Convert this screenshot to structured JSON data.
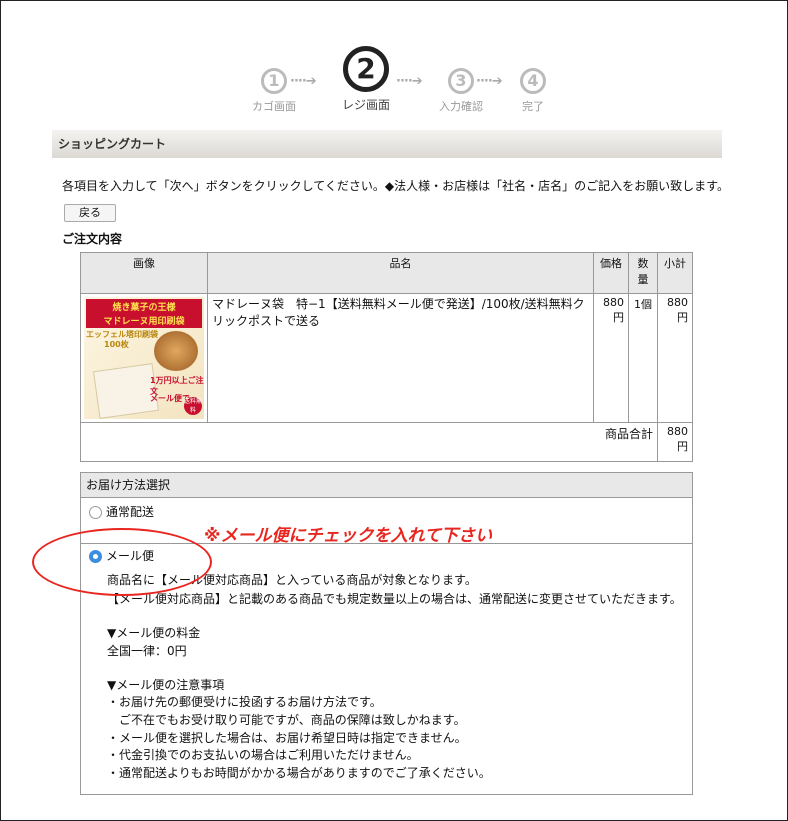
{
  "steps": [
    {
      "num": "1",
      "label": "カゴ画面"
    },
    {
      "num": "2",
      "label": "レジ画面"
    },
    {
      "num": "3",
      "label": "入力確認"
    },
    {
      "num": "4",
      "label": "完了"
    }
  ],
  "arrow": "····➔",
  "cart_header": "ショッピングカート",
  "instruction": "各項目を入力して「次へ」ボタンをクリックしてください。◆法人様・お店様は「社名・店名」のご記入をお願い致します。",
  "back_button": "戻る",
  "order_title": "ご注文内容",
  "table": {
    "headers": {
      "image": "画像",
      "name": "品名",
      "price": "価格",
      "qty": "数量",
      "subtotal": "小計"
    },
    "row": {
      "name": "マドレーヌ袋　特−1【送料無料メール便で発送】/100枚/送料無料クリックポストで送る",
      "price": "880円",
      "qty": "1個",
      "subtotal": "880円"
    },
    "total_label": "商品合計",
    "total_value": "880円",
    "thumb": {
      "line1": "焼き菓子の王様",
      "line2": "マドレーヌ用印刷袋",
      "line3": "エッフェル塔印刷袋",
      "line4": "100枚",
      "line5": "1万円以上ご注文",
      "line6": "メール便で",
      "badge": "送料無料"
    }
  },
  "delivery": {
    "header": "お届け方法選択",
    "option_normal": "通常配送",
    "option_mail": "メール便",
    "note1": "商品名に【メール便対応商品】と入っている商品が対象となります。",
    "note2": "【メール便対応商品】と記載のある商品でも規定数量以上の場合は、通常配送に変更させていただきます。",
    "fee_title": "▼メール便の料金",
    "fee_value": "全国一律：0円",
    "caution_title": "▼メール便の注意事項",
    "caution": [
      "・お届け先の郵便受けに投函するお届け方法です。",
      "　ご不在でもお受け取り可能ですが、商品の保障は致しかねます。",
      "・メール便を選択した場合は、お届け希望日時は指定できません。",
      "・代金引換でのお支払いの場合はご利用いただけません。",
      "・通常配送よりもお時間がかかる場合がありますのでご了承ください。"
    ]
  },
  "annotation": "※メール便にチェックを入れて下さい",
  "colors": {
    "accent_red": "#e8261f",
    "radio_blue": "#3b8de0"
  }
}
